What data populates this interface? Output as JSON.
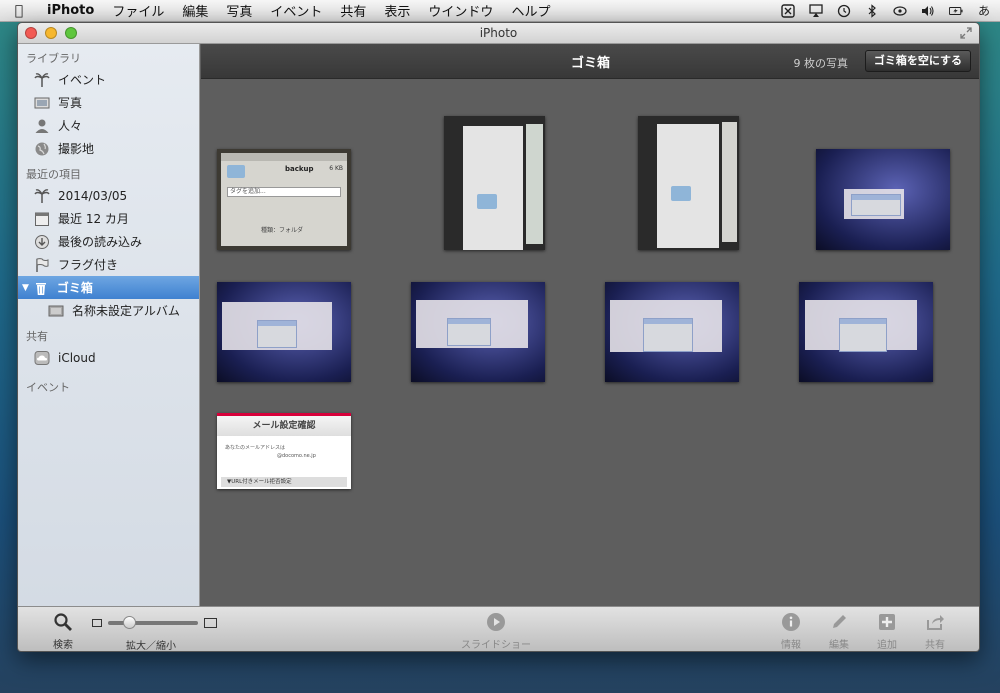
{
  "menubar": {
    "app": "iPhoto",
    "items": [
      "ファイル",
      "編集",
      "写真",
      "イベント",
      "共有",
      "表示",
      "ウインドウ",
      "ヘルプ"
    ],
    "input_method": "あ"
  },
  "window": {
    "title": "iPhoto"
  },
  "sidebar": {
    "sections": [
      {
        "title": "ライブラリ",
        "items": [
          {
            "label": "イベント",
            "icon": "palm-tree-icon"
          },
          {
            "label": "写真",
            "icon": "photo-icon"
          },
          {
            "label": "人々",
            "icon": "person-icon"
          },
          {
            "label": "撮影地",
            "icon": "globe-icon"
          }
        ]
      },
      {
        "title": "最近の項目",
        "items": [
          {
            "label": "2014/03/05",
            "icon": "palm-tree-icon"
          },
          {
            "label": "最近 12 カ月",
            "icon": "calendar-icon"
          },
          {
            "label": "最後の読み込み",
            "icon": "import-icon"
          },
          {
            "label": "フラグ付き",
            "icon": "flag-icon"
          },
          {
            "label": "ゴミ箱",
            "icon": "trash-icon",
            "selected": true
          },
          {
            "label": "名称未設定アルバム",
            "icon": "album-icon"
          }
        ]
      },
      {
        "title": "共有",
        "items": [
          {
            "label": "iCloud",
            "icon": "cloud-icon"
          }
        ]
      },
      {
        "title": "イベント",
        "items": []
      }
    ]
  },
  "main": {
    "title": "ゴミ箱",
    "count": "9 枚の写真",
    "empty_button": "ゴミ箱を空にする",
    "mail_thumb": {
      "heading": "メール設定確認",
      "line1": "あなたのメールアドレスは",
      "line2": "@docomo.ne.jp",
      "footer": "▼URL付きメール拒否設定"
    },
    "finder_thumb": {
      "name": "backup",
      "size": "6 KB",
      "tag": "タグを追加...",
      "kind": "種類：フォルダ"
    }
  },
  "bottombar": {
    "search": "検索",
    "zoom": "拡大／縮小",
    "zoom_level": 0.2,
    "slideshow": "スライドショー",
    "info": "情報",
    "edit": "編集",
    "add": "追加",
    "share": "共有"
  }
}
